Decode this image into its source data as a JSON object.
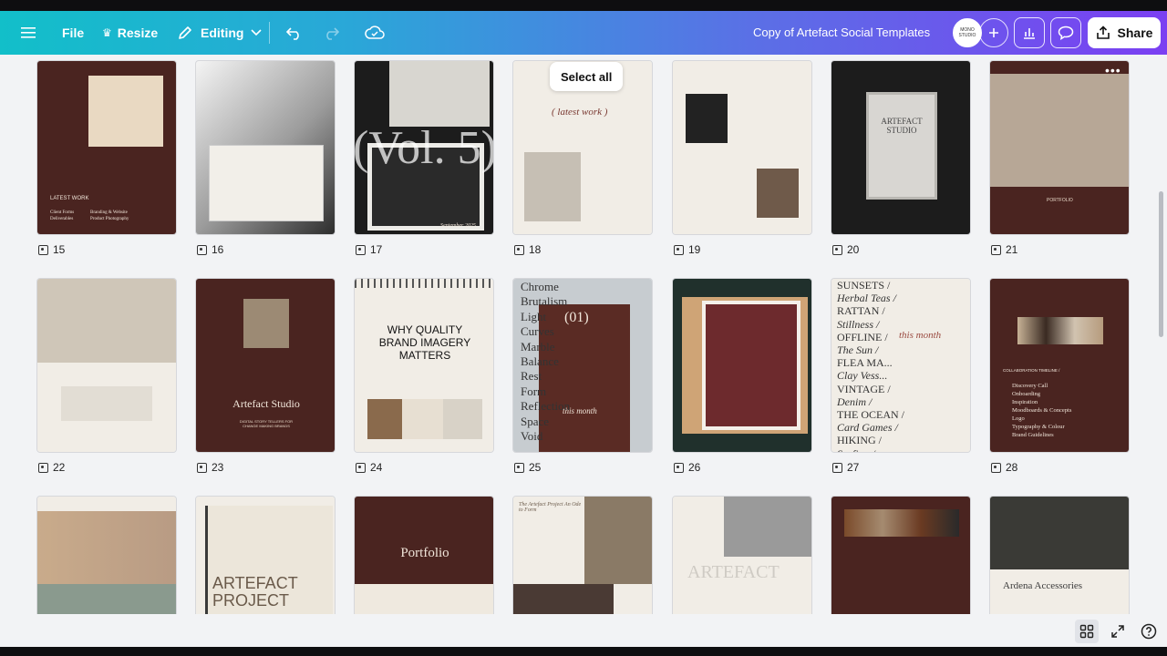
{
  "topbar": {
    "file_label": "File",
    "resize_label": "Resize",
    "editing_label": "Editing",
    "doc_title": "Copy of Artefact Social Templates",
    "avatar_text": "MONO STUDIO",
    "share_label": "Share"
  },
  "canvas": {
    "select_all_label": "Select all",
    "more_dots": "•••"
  },
  "pages": [
    {
      "number": "15",
      "style": "brown"
    },
    {
      "number": "16",
      "style": "grey"
    },
    {
      "number": "17",
      "style": "dark"
    },
    {
      "number": "18",
      "style": "cream"
    },
    {
      "number": "19",
      "style": "cream"
    },
    {
      "number": "20",
      "style": "dark"
    },
    {
      "number": "21",
      "style": "brown"
    },
    {
      "number": "22",
      "style": "cream"
    },
    {
      "number": "23",
      "style": "brown"
    },
    {
      "number": "24",
      "style": "cream"
    },
    {
      "number": "25",
      "style": "grey"
    },
    {
      "number": "26",
      "style": "green"
    },
    {
      "number": "27",
      "style": "cream"
    },
    {
      "number": "28",
      "style": "brown"
    },
    {
      "number": "",
      "style": "cream"
    },
    {
      "number": "",
      "style": "cream"
    },
    {
      "number": "",
      "style": "brown"
    },
    {
      "number": "",
      "style": "cream"
    },
    {
      "number": "",
      "style": "cream"
    },
    {
      "number": "",
      "style": "brown"
    },
    {
      "number": "",
      "style": "cream"
    }
  ],
  "thumb_text": {
    "p15_title": "LATEST WORK",
    "p15_l1": "Client Forms",
    "p15_l2": "Deliverables",
    "p15_r1": "Branding & Website",
    "p15_r2": "Product Photography",
    "p17_big": "(Vol. 5)",
    "p17_date": "September 2025",
    "p18_script": "( latest work )",
    "p20_title": "ARTEFACT STUDIO",
    "p21_label": "PORTFOLIO",
    "p23_title": "Artefact Studio",
    "p23_sub": "DIGITAL STORY TELLERS FOR CHANGE MAKING BRANDS",
    "p24_title": "WHY QUALITY BRAND IMAGERY MATTERS",
    "p25_words": [
      "Chrome",
      "Brutalism",
      "Light",
      "Curves",
      "Marble",
      "Balance",
      "Rest",
      "Form",
      "Reflection",
      "Space",
      "Void"
    ],
    "p25_num": "(01)",
    "p25_script": "this month",
    "p27_words": [
      "SUNSETS /",
      "Herbal Teas /",
      "RATTAN /",
      "Stillness /",
      "OFFLINE /",
      "The Sun /",
      "FLEA MA...",
      "Clay Vess...",
      "VINTAGE /",
      "Denim /",
      "THE OCEAN /",
      "Card Games /",
      "HIKING /",
      "Surfing /"
    ],
    "p27_script": "this month",
    "p28_heading": "COLLABORATION TIMELINE /",
    "p28_items": [
      "Discovery Call",
      "Onboarding",
      "Inspiration",
      "Moodboards & Concepts",
      "Logo",
      "Typography & Colour",
      "Brand Guidelines"
    ],
    "p31_title": "ARTEFACT PROJECT",
    "p32_title": "Portfolio",
    "p33_title": "The Artefact Project An Ode to Form",
    "p34_title": "ARTEFACT",
    "p36_title": "Ardena Accessories"
  }
}
